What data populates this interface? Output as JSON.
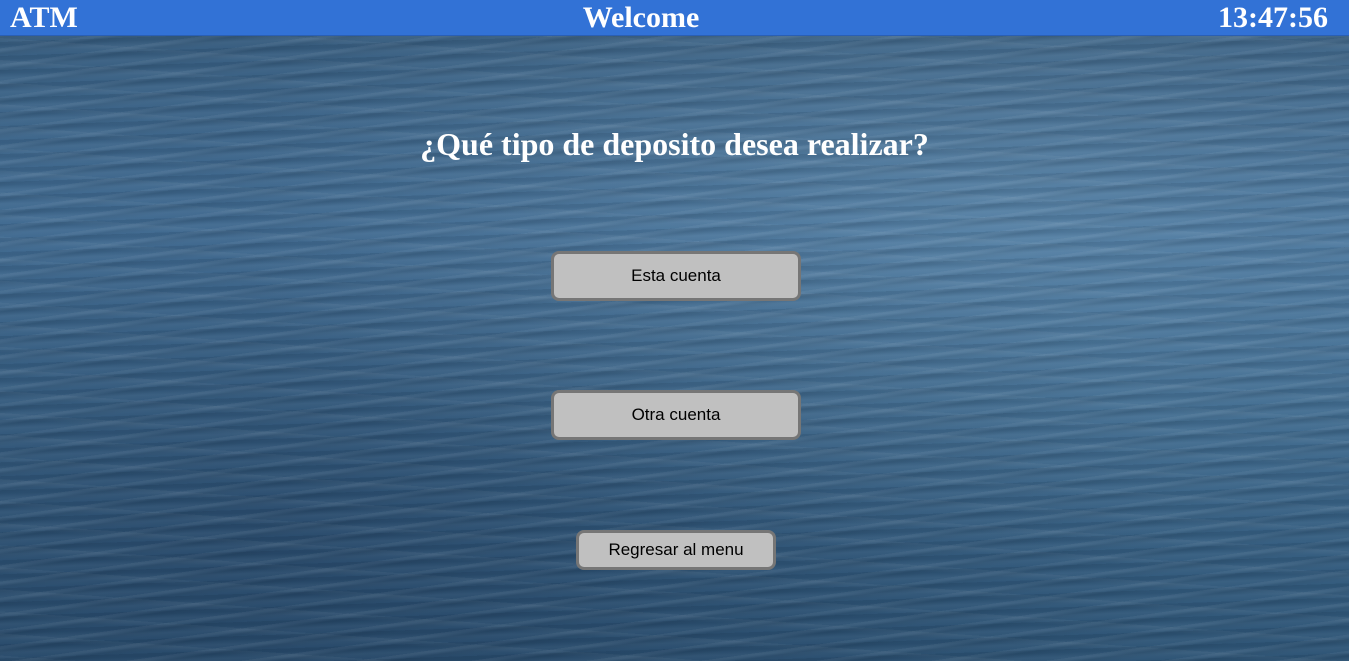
{
  "header": {
    "app_name": "ATM",
    "title": "Welcome",
    "clock": "13:47:56"
  },
  "main": {
    "question": "¿Qué tipo de deposito desea realizar?",
    "options": {
      "this_account": "Esta cuenta",
      "other_account": "Otra cuenta"
    },
    "back_label": "Regresar al menu"
  },
  "colors": {
    "header_background": "#3272d6",
    "button_background": "#c0c0c0",
    "button_border": "#767676",
    "water_background": "#3e6685"
  }
}
